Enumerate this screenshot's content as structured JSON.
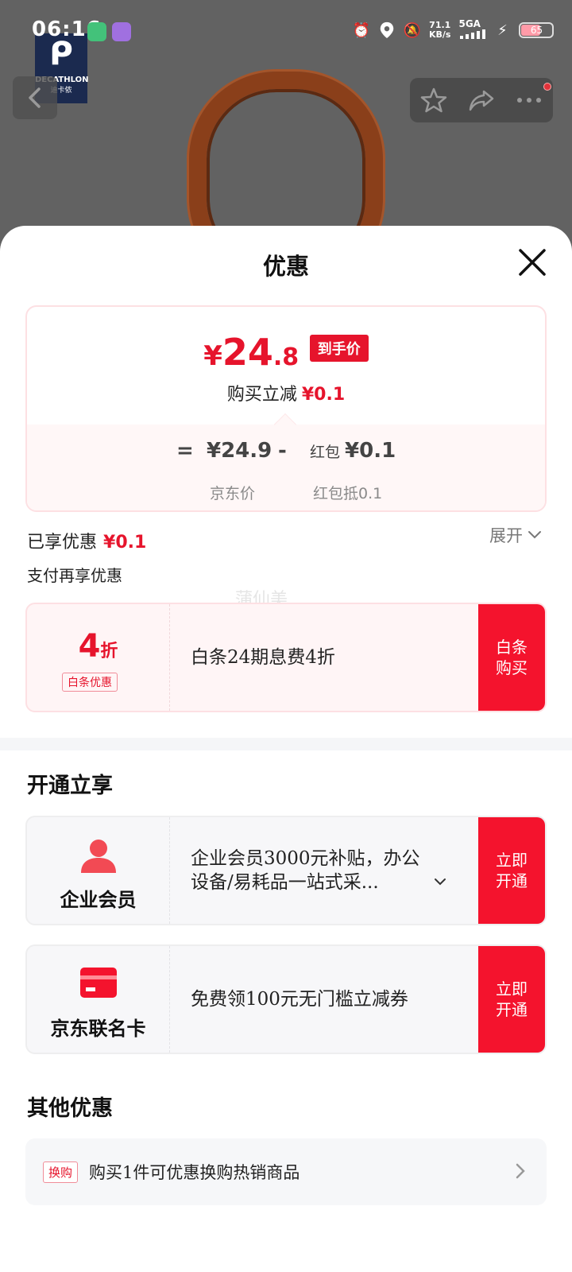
{
  "status_bar": {
    "time": "06:16",
    "speed_value": "71.1",
    "speed_unit": "KB/s",
    "network": "5GA",
    "battery": "65"
  },
  "brand": {
    "logo_text": "DECATHLON",
    "logo_cn": "迪卡侬"
  },
  "sheet": {
    "title": "优惠",
    "price_card": {
      "currency": "¥",
      "final_int": "24",
      "final_dec": ".8",
      "final_tag": "到手价",
      "reduce_label": "购买立减",
      "reduce_value": "¥0.1",
      "equals": "=",
      "jd_price": "¥24.9",
      "minus": "-",
      "hongbao_label": "红包",
      "hongbao_value": "¥0.1",
      "jd_price_label": "京东价",
      "hongbao_sub_label": "红包抵0.1"
    },
    "enjoyed_label": "已享优惠",
    "enjoyed_value": "¥0.1",
    "expand_label": "展开",
    "pay_more_label": "支付再享优惠",
    "watermark": "蒲仙美",
    "baitiao": {
      "discount_num": "4",
      "discount_unit": "折",
      "tag": "白条优惠",
      "desc": "白条24期息费4折",
      "button": "白条购买"
    },
    "open_section_title": "开通立享",
    "enterprise": {
      "label": "企业会员",
      "desc": "企业会员3000元补贴，办公设备/易耗品一站式采...",
      "button": "立即开通"
    },
    "co_card": {
      "label": "京东联名卡",
      "desc": "免费领100元无门槛立减券",
      "button": "立即开通"
    },
    "other_section_title": "其他优惠",
    "swap": {
      "tag": "换购",
      "text": "购买1件可优惠换购热销商品"
    }
  },
  "colors": {
    "accent_red": "#e6142c",
    "button_red": "#f4132d"
  }
}
